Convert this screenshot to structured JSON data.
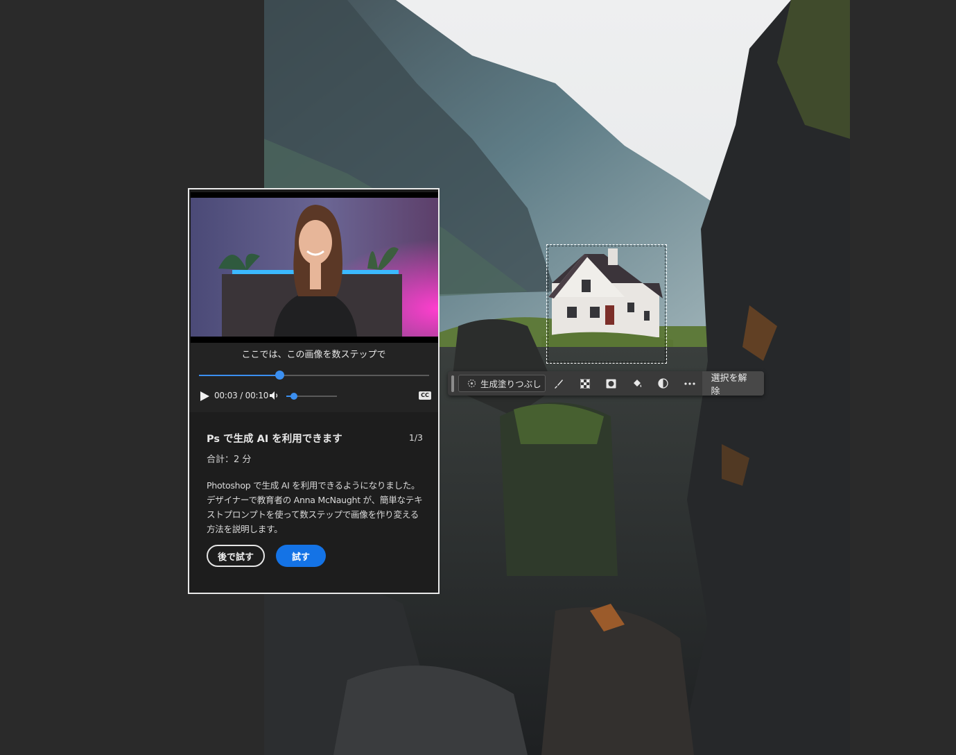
{
  "panel": {
    "caption": "ここでは、この画像を数ステップで",
    "playback": {
      "current_time": "00:03",
      "duration": "00:10",
      "time_display": "00:03 / 00:10",
      "progress_fraction": 0.35,
      "volume_fraction": 0.15
    },
    "cc_label": "CC",
    "title": "Ps で生成 AI を利用できます",
    "step_counter": "1/3",
    "total_time": "合計：2 分",
    "description": "Photoshop で生成 AI を利用できるようになりました。デザイナーで教育者の Anna McNaught が、簡単なテキストプロンプトを使って数ステップで画像を作り変える方法を説明します。",
    "buttons": {
      "later": "後で試す",
      "try": "試す"
    }
  },
  "taskbar": {
    "generative_fill": "生成塗りつぶし",
    "tools": [
      "brush-icon",
      "checkerboard-icon",
      "mask-icon",
      "fill-bucket-icon",
      "adjustment-icon",
      "more-icon"
    ],
    "deselect": "選択を解除"
  },
  "colors": {
    "accent": "#1473e6",
    "progress": "#3b8ff0",
    "panel_bg": "#1d1d1d",
    "taskbar_bg": "#3a3a3a",
    "app_bg": "#2a2a2a"
  }
}
